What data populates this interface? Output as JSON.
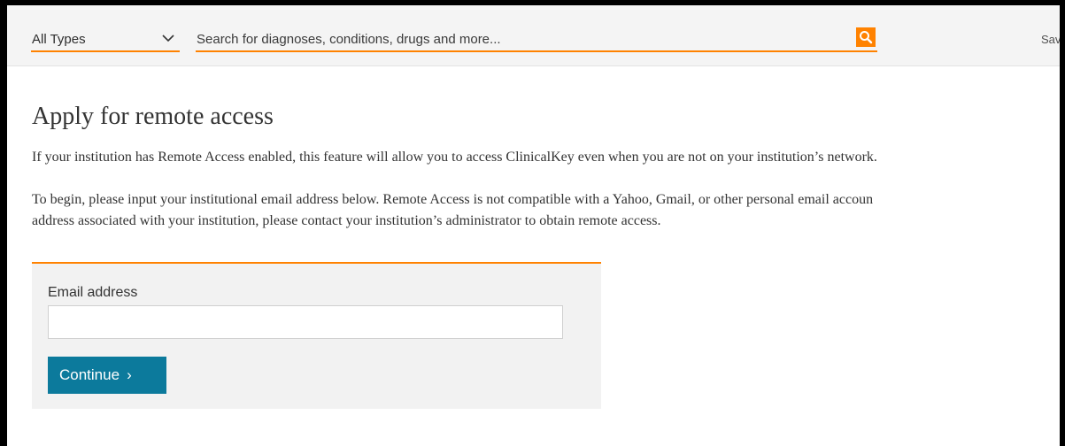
{
  "search_bar": {
    "type_selected": "All Types",
    "search_placeholder": "Search for diagnoses, conditions, drugs and more...",
    "save_label": "Sav"
  },
  "page": {
    "title": "Apply for remote access",
    "paragraph1": "If your institution has Remote Access enabled, this feature will allow you to access ClinicalKey even when you are not on your institution’s network.",
    "paragraph2_line1": "To begin, please input your institutional email address below. Remote Access is not compatible with a Yahoo, Gmail, or other personal email accoun",
    "paragraph2_line2": "address associated with your institution, please contact your institution’s administrator to obtain remote access."
  },
  "form": {
    "email_label": "Email address",
    "email_value": "",
    "continue_label": "Continue",
    "continue_arrow": "›"
  },
  "colors": {
    "accent": "#ff8200",
    "button": "#0c7a9c"
  }
}
